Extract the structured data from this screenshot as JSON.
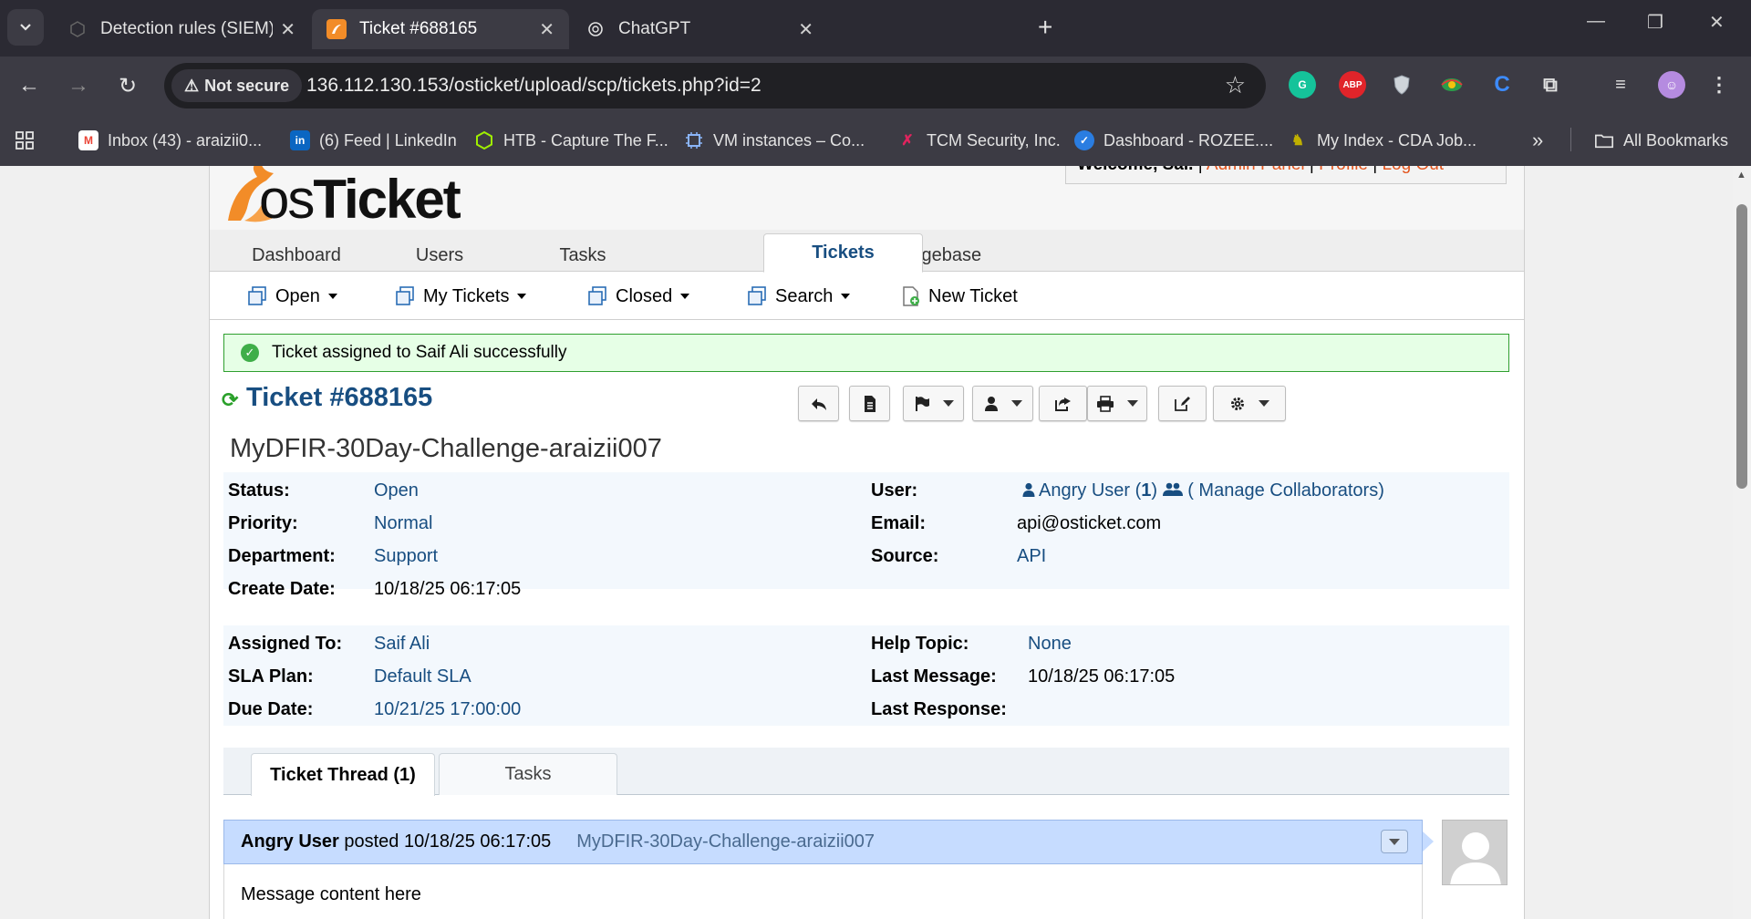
{
  "browser": {
    "tabs": [
      {
        "title": "Detection rules (SIEM) - Kibana",
        "active": false
      },
      {
        "title": "Ticket #688165",
        "active": true
      },
      {
        "title": "ChatGPT",
        "active": false
      }
    ],
    "security_label": "Not secure",
    "url": "136.112.130.153/osticket/upload/scp/tickets.php?id=2",
    "extensions": [
      "grammarly-icon",
      "adblock-icon",
      "shield-extension-icon",
      "colorful-extension-icon",
      "c-extension-icon",
      "puzzle-icon",
      "media-control-icon",
      "profile-avatar"
    ],
    "abp_label": "ABP",
    "bookmarks": [
      {
        "label": "Inbox (43) - araizii0...",
        "icon": "gmail-icon",
        "color": "#ea4335"
      },
      {
        "label": "(6) Feed | LinkedIn",
        "icon": "linkedin-icon",
        "color": "#0a66c2"
      },
      {
        "label": "HTB - Capture The F...",
        "icon": "htb-icon",
        "color": "#9fef00"
      },
      {
        "label": "VM instances – Co...",
        "icon": "chip-icon",
        "color": "#5b8def"
      },
      {
        "label": "TCM Security, Inc.",
        "icon": "tcm-icon",
        "color": "#e0245e"
      },
      {
        "label": "Dashboard - ROZEE....",
        "icon": "rozee-icon",
        "color": "#2a7de1"
      },
      {
        "label": "My Index - CDA Job...",
        "icon": "cda-icon",
        "color": "#c0b000"
      }
    ],
    "overflow_label": "»",
    "all_bookmarks": "All Bookmarks"
  },
  "header": {
    "welcome_prefix": "Welcome, Sai.",
    "links": [
      "Admin Panel",
      "Profile",
      "Log Out"
    ],
    "separator": "|",
    "logo_os": "os",
    "logo_ticket": "Ticket"
  },
  "nav": {
    "tabs": [
      "Dashboard",
      "Users",
      "Tasks",
      "Tickets",
      "Knowledgebase"
    ],
    "active": "Tickets"
  },
  "subnav": {
    "items": [
      "Open",
      "My Tickets",
      "Closed",
      "Search",
      "New Ticket"
    ]
  },
  "notice": "Ticket assigned to Saif Ali successfully",
  "ticket": {
    "title": "Ticket #688165",
    "subject": "MyDFIR-30Day-Challenge-araizii007",
    "left1": [
      {
        "label": "Status:",
        "value": "Open"
      },
      {
        "label": "Priority:",
        "value": "Normal"
      },
      {
        "label": "Department:",
        "value": "Support"
      },
      {
        "label": "Create Date:",
        "value": "10/18/25 06:17:05"
      }
    ],
    "right1": [
      {
        "label": "User:",
        "value": "Angry User",
        "count_open": "(",
        "count": "1",
        "count_close": ")",
        "collab": "( Manage Collaborators)"
      },
      {
        "label": "Email:",
        "value": "api@osticket.com"
      },
      {
        "label": "Source:",
        "value": "API"
      }
    ],
    "left2": [
      {
        "label": "Assigned To:",
        "value": "Saif Ali"
      },
      {
        "label": "SLA Plan:",
        "value": "Default SLA"
      },
      {
        "label": "Due Date:",
        "value": "10/21/25 17:00:00"
      }
    ],
    "right2": [
      {
        "label": "Help Topic:",
        "value": "None"
      },
      {
        "label": "Last Message:",
        "value": "10/18/25 06:17:05"
      },
      {
        "label": "Last Response:",
        "value": ""
      }
    ]
  },
  "thread": {
    "tabs": [
      "Ticket Thread (1)",
      "Tasks"
    ],
    "entry": {
      "author": "Angry User",
      "posted": "posted 10/18/25 06:17:05",
      "title": "MyDFIR-30Day-Challenge-araizii007",
      "body": "Message content here"
    }
  },
  "colors": {
    "link": "#184e81",
    "brand_orange": "#f28c28",
    "notice_bg": "#e6ffe6",
    "thread_header": "#c6dcff"
  }
}
